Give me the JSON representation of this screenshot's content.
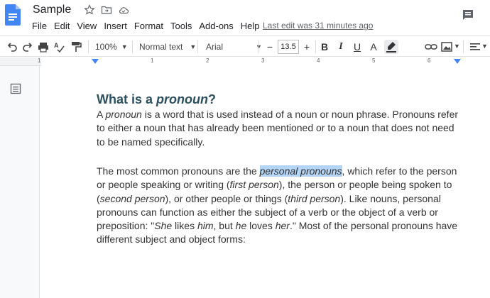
{
  "header": {
    "title": "Sample",
    "menu": [
      "File",
      "Edit",
      "View",
      "Insert",
      "Format",
      "Tools",
      "Add-ons",
      "Help"
    ],
    "last_edit": "Last edit was 31 minutes ago"
  },
  "toolbar": {
    "zoom": "100%",
    "style": "Normal text",
    "font": "Arial",
    "font_size": "13.5",
    "minus": "−",
    "plus": "+",
    "bold": "B",
    "italic": "I",
    "underline": "U",
    "text_color": "A"
  },
  "ruler": {
    "numbers": [
      "1",
      "1",
      "2",
      "3",
      "4",
      "5",
      "6"
    ]
  },
  "doc": {
    "heading_prefix": "What is a ",
    "heading_em": "pronoun",
    "heading_suffix": "?",
    "p1": {
      "a": "A ",
      "pronoun": "pronoun",
      "rest": " is a word that is used instead of a noun or noun phrase. Pronouns refer to either a noun that has already been mentioned or to a noun that does not need to be named specifically."
    },
    "p2": {
      "s1": "The most common pronouns are the ",
      "personal_pronouns": "personal pronouns",
      "s2": ", which refer to the person or people speaking or writing (",
      "first_person": "first person",
      "s3": "), the person or people being spoken to (",
      "second_person": "second person",
      "s4": "), or other people or things (",
      "third_person": "third person",
      "s5": "). Like nouns, personal pronouns can function as either the subject of a verb or the object of a verb or preposition: \"",
      "she": "She",
      "s6": " likes ",
      "him": "him",
      "s7": ", but ",
      "he": "he",
      "s8": " loves ",
      "her": "her",
      "s9": ".\" Most of the personal pronouns have different subject and object forms:"
    }
  },
  "colors": {
    "docs_blue": "#4285f4",
    "heading": "#2c4f60",
    "highlight": "#b4d4f5",
    "arrow_red": "#e02020"
  }
}
